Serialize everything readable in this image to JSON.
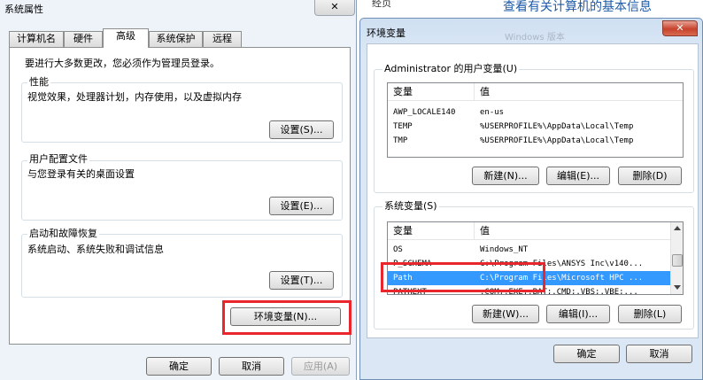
{
  "background": {
    "sys_props_title": "系统属性",
    "partial_title": "经页",
    "link_text": "查看有关计算机的基本信息",
    "blurred_text": "Windows 版本"
  },
  "sysprops": {
    "tabs": [
      "计算机名",
      "硬件",
      "高级",
      "系统保护",
      "远程"
    ],
    "admin_note": "要进行大多数更改，您必须作为管理员登录。",
    "performance": {
      "title": "性能",
      "desc": "视觉效果，处理器计划，内存使用，以及虚拟内存",
      "button": "设置(S)..."
    },
    "profiles": {
      "title": "用户配置文件",
      "desc": "与您登录有关的桌面设置",
      "button": "设置(E)..."
    },
    "startup": {
      "title": "启动和故障恢复",
      "desc": "系统启动、系统失败和调试信息",
      "button": "设置(T)..."
    },
    "env_button": "环境变量(N)...",
    "ok": "确定",
    "cancel": "取消",
    "apply": "应用(A)"
  },
  "envvars": {
    "title": "环境变量",
    "close_glyph": "✕",
    "user_group": "Administrator 的用户变量(U)",
    "system_group": "系统变量(S)",
    "col_var": "变量",
    "col_val": "值",
    "user_rows": [
      {
        "name": "AWP_LOCALE140",
        "value": "en-us"
      },
      {
        "name": "TEMP",
        "value": "%USERPROFILE%\\AppData\\Local\\Temp"
      },
      {
        "name": "TMP",
        "value": "%USERPROFILE%\\AppData\\Local\\Temp"
      }
    ],
    "system_rows": [
      {
        "name": "OS",
        "value": "Windows_NT"
      },
      {
        "name": "P_SCHEMA",
        "value": "C:\\Program Files\\ANSYS Inc\\v140..."
      },
      {
        "name": "Path",
        "value": "C:\\Program Files\\Microsoft HPC ..."
      },
      {
        "name": "PATHEXT",
        "value": ".COM;.EXE;.BAT;.CMD;.VBS;.VBE;..."
      }
    ],
    "new_user": "新建(N)...",
    "edit_user": "编辑(E)...",
    "delete_user": "删除(D)",
    "new_sys": "新建(W)...",
    "edit_sys": "编辑(I)...",
    "delete_sys": "删除(L)",
    "ok": "确定",
    "cancel": "取消"
  },
  "colors": {
    "selection": "#3399ff",
    "highlight": "#e8262b",
    "link": "#1e5aa8"
  }
}
